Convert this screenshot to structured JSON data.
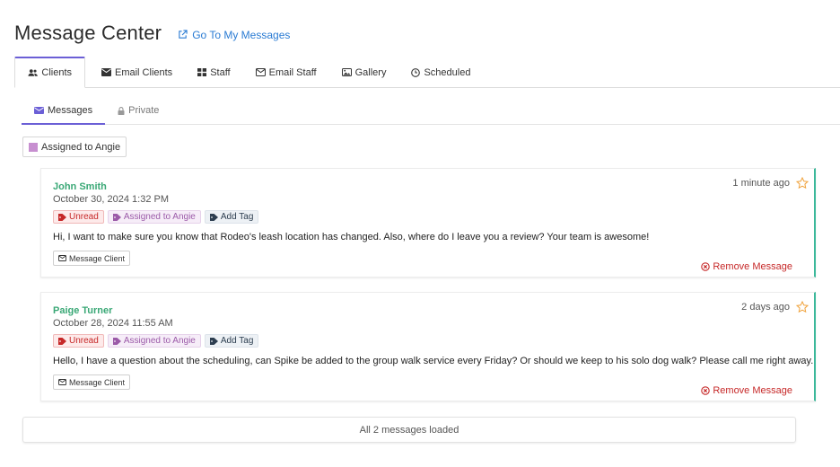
{
  "header": {
    "title": "Message Center",
    "link_label": "Go To My Messages"
  },
  "tabs": [
    {
      "label": "Clients",
      "icon": "users-icon",
      "active": true
    },
    {
      "label": "Email Clients",
      "icon": "envelope-icon"
    },
    {
      "label": "Staff",
      "icon": "grid-icon"
    },
    {
      "label": "Email Staff",
      "icon": "envelope-outline-icon"
    },
    {
      "label": "Gallery",
      "icon": "image-icon"
    },
    {
      "label": "Scheduled",
      "icon": "clock-icon"
    }
  ],
  "subtabs": [
    {
      "label": "Messages",
      "icon": "envelope-icon",
      "active": true
    },
    {
      "label": "Private",
      "icon": "lock-icon"
    }
  ],
  "filter": {
    "label": "Assigned to Angie",
    "color": "#c78fd0"
  },
  "messages": [
    {
      "sender": "John Smith",
      "date": "October 30, 2024 1:32 PM",
      "time_ago": "1 minute ago",
      "tags": {
        "unread": "Unread",
        "assigned": "Assigned to Angie",
        "add": "Add Tag"
      },
      "body": "Hi, I want to make sure you know that Rodeo's leash location has changed. Also, where do I leave you a review? Your team is awesome!",
      "action_label": "Message Client",
      "remove_label": "Remove Message"
    },
    {
      "sender": "Paige Turner",
      "date": "October 28, 2024 11:55 AM",
      "time_ago": "2 days ago",
      "tags": {
        "unread": "Unread",
        "assigned": "Assigned to Angie",
        "add": "Add Tag"
      },
      "body": "Hello, I have a question about the scheduling, can Spike be added to the group walk service every Friday? Or should we keep to his solo dog walk? Please call me right away.",
      "action_label": "Message Client",
      "remove_label": "Remove Message"
    }
  ],
  "footer": {
    "status": "All 2 messages loaded"
  },
  "colors": {
    "accent": "#6b5fd6",
    "sender": "#3aa876",
    "danger": "#c62828",
    "link": "#2a7bd3",
    "card_border": "#3bb89a"
  }
}
